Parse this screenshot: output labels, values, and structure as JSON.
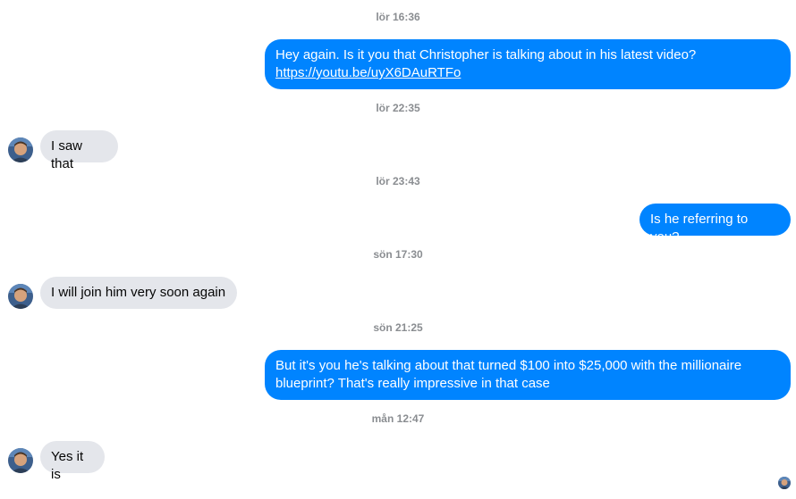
{
  "conversation": {
    "timestamps": [
      "lör 16:36",
      "lör 22:35",
      "lör 23:43",
      "sön 17:30",
      "sön 21:25",
      "mån 12:47"
    ],
    "messages": [
      {
        "sender": "me",
        "text_line1": "Hey again. Is it you that Christopher is talking about in his latest video?",
        "link": "https://youtu.be/uyX6DAuRTFo"
      },
      {
        "sender": "contact",
        "text": "I saw that"
      },
      {
        "sender": "me",
        "text": "Is he referring to you?"
      },
      {
        "sender": "contact",
        "text": "I will join him very soon again"
      },
      {
        "sender": "me",
        "text": "But it's you he's talking about that turned $100 into $25,000 with the millionaire blueprint? That's really impressive in that case"
      },
      {
        "sender": "contact",
        "text": "Yes it is"
      }
    ]
  },
  "colors": {
    "outgoing_bubble": "#0084ff",
    "incoming_bubble": "#e4e6eb",
    "timestamp_text": "#8a8d91"
  },
  "icons": {
    "contact_avatar": "contact-avatar",
    "seen_indicator": "seen-avatar"
  }
}
